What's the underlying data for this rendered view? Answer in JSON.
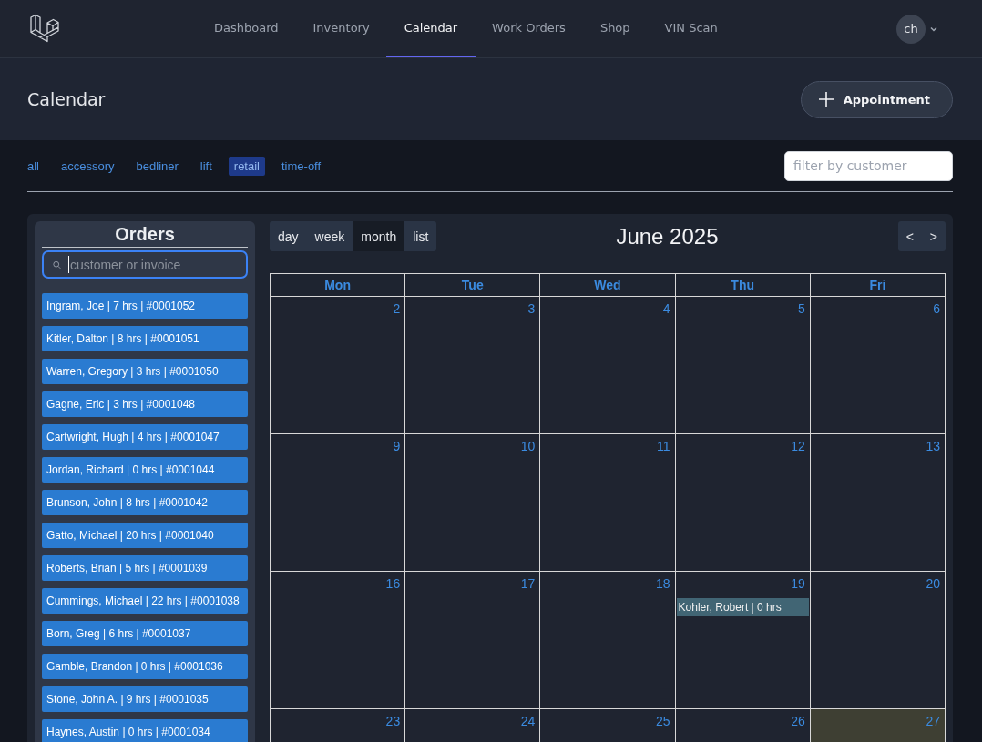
{
  "nav": {
    "items": [
      {
        "label": "Dashboard",
        "selected": false
      },
      {
        "label": "Inventory",
        "selected": false
      },
      {
        "label": "Calendar",
        "selected": true
      },
      {
        "label": "Work Orders",
        "selected": false
      },
      {
        "label": "Shop",
        "selected": false
      },
      {
        "label": "VIN Scan",
        "selected": false
      }
    ],
    "user_initials": "ch"
  },
  "header": {
    "title": "Calendar",
    "button": "Appointment"
  },
  "filters": {
    "tags": [
      {
        "label": "all",
        "selected": false
      },
      {
        "label": "accessory",
        "selected": false
      },
      {
        "label": "bedliner",
        "selected": false
      },
      {
        "label": "lift",
        "selected": false
      },
      {
        "label": "retail",
        "selected": true
      },
      {
        "label": "time-off",
        "selected": false
      }
    ],
    "search": {
      "placeholder": "filter by customer"
    }
  },
  "orders": {
    "title": "Orders",
    "search": {
      "placeholder": "customer or invoice"
    },
    "items": [
      "Ingram, Joe | 7 hrs | #0001052",
      "Kitler, Dalton | 8 hrs | #0001051",
      "Warren, Gregory | 3 hrs | #0001050",
      "Gagne, Eric | 3 hrs | #0001048",
      "Cartwright, Hugh | 4 hrs | #0001047",
      "Jordan, Richard | 0 hrs | #0001044",
      "Brunson, John | 8 hrs | #0001042",
      "Gatto, Michael | 20 hrs | #0001040",
      "Roberts, Brian | 5 hrs | #0001039",
      "Cummings, Michael | 22 hrs | #0001038",
      "Born, Greg | 6 hrs | #0001037",
      "Gamble, Brandon | 0 hrs | #0001036",
      "Stone, John A. | 9 hrs | #0001035",
      "Haynes, Austin | 0 hrs | #0001034"
    ]
  },
  "calendar": {
    "views": [
      {
        "label": "day",
        "selected": false
      },
      {
        "label": "week",
        "selected": false
      },
      {
        "label": "month",
        "selected": true
      },
      {
        "label": "list",
        "selected": false
      }
    ],
    "title": "June 2025",
    "prev": "<",
    "next": ">",
    "weekdays": [
      "Mon",
      "Tue",
      "Wed",
      "Thu",
      "Fri"
    ],
    "weeks": [
      [
        {
          "date": "2",
          "today": false
        },
        {
          "date": "3",
          "today": false
        },
        {
          "date": "4",
          "today": false
        },
        {
          "date": "5",
          "today": false
        },
        {
          "date": "6",
          "today": false
        }
      ],
      [
        {
          "date": "9",
          "today": false
        },
        {
          "date": "10",
          "today": false
        },
        {
          "date": "11",
          "today": false
        },
        {
          "date": "12",
          "today": false
        },
        {
          "date": "13",
          "today": false
        }
      ],
      [
        {
          "date": "16",
          "today": false
        },
        {
          "date": "17",
          "today": false
        },
        {
          "date": "18",
          "today": false
        },
        {
          "date": "19",
          "today": false,
          "events": [
            "Kohler, Robert | 0 hrs"
          ]
        },
        {
          "date": "20",
          "today": false
        }
      ],
      [
        {
          "date": "23",
          "today": false
        },
        {
          "date": "24",
          "today": false
        },
        {
          "date": "25",
          "today": false
        },
        {
          "date": "26",
          "today": false
        },
        {
          "date": "27",
          "today": true
        }
      ]
    ]
  }
}
